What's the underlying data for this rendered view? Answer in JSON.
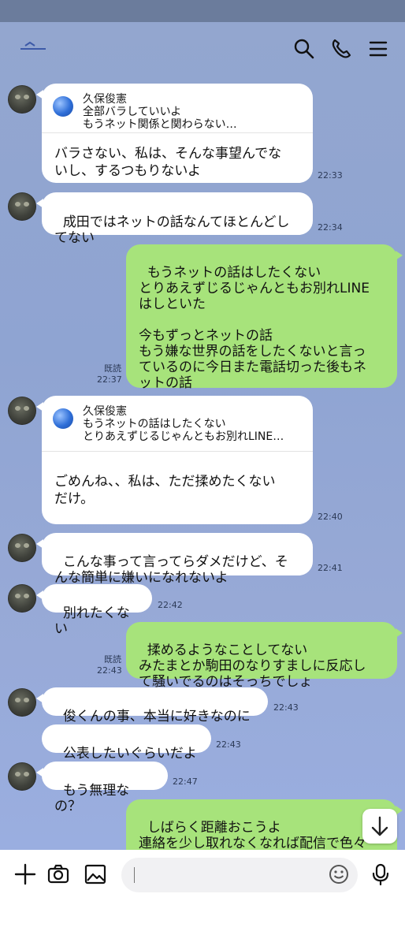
{
  "messages": {
    "m1": {
      "sender": "久保俊憲",
      "quote_name": "久保俊憲",
      "quote_text": "全部バラしていいよ\nもうネット関係と関わらない…",
      "text": "バラさない、私は、そんな事望んでな\nいし、するつもりないよ",
      "time": "22:33"
    },
    "m2": {
      "text": "成田ではネットの話なんてほとんどし\nてない",
      "time": "22:34"
    },
    "m3": {
      "text": "もうネットの話はしたくない\nとりあえずじるじゃんともお別れLINE\nはしといた\n\n今もずっとネットの話\nもう嫌な世界の話をしたくないと言っ\nているのに今日また電話切った後もネ\nットの話",
      "read": "既読",
      "time": "22:37"
    },
    "m4": {
      "quote_name": "久保俊憲",
      "quote_text": "もうネットの話はしたくない\nとりあえずじるじゃんともお別れLINE…",
      "text": "ごめんね、、私は、ただ揉めたくない\nだけ。",
      "time": "22:40"
    },
    "m5": {
      "text": "こんな事って言ってらダメだけど、そ\nんな簡単に嫌いになれないよ",
      "time": "22:41"
    },
    "m6": {
      "text": "別れたくない",
      "time": "22:42"
    },
    "m7": {
      "text": "揉めるようなことしてない\nみたまとか駒田のなりすましに反応し\nて騒いでるのはそっちでしょ",
      "read": "既読",
      "time": "22:43"
    },
    "m8": {
      "text": "俊くんの事、本当に好きなのに",
      "time": "22:43"
    },
    "m9": {
      "text": "公表したいぐらいだよ",
      "time": "22:43"
    },
    "m10": {
      "text": "もう無理なの？",
      "time": "22:47"
    },
    "m11": {
      "text": "しばらく距離おこうよ\n連絡を少し取れなくなれば配信で色々\n言われ、口論になれば裁判協力しない"
    }
  },
  "header": {
    "icons": [
      "back-icon",
      "search-icon",
      "phone-icon",
      "menu-icon"
    ]
  },
  "footer": {
    "icons": [
      "plus-icon",
      "camera-icon",
      "image-icon",
      "emoji-icon",
      "mic-icon"
    ],
    "input_value": ""
  },
  "colors": {
    "background": "#93a6cf",
    "incoming": "#ffffff",
    "outgoing": "#a7e37b"
  }
}
